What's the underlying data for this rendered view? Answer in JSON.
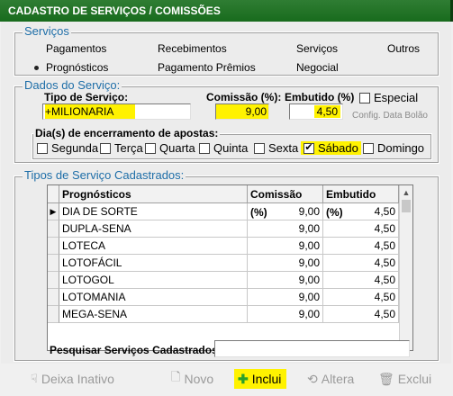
{
  "window": {
    "title": "CADASTRO DE SERVIÇOS / COMISSÕES"
  },
  "servicos": {
    "legend": "Serviços",
    "options": [
      {
        "label": "Pagamentos",
        "selected": false
      },
      {
        "label": "Recebimentos",
        "selected": false
      },
      {
        "label": "Serviços",
        "selected": false
      },
      {
        "label": "Outros",
        "selected": false
      },
      {
        "label": "Prognósticos",
        "selected": true
      },
      {
        "label": "Pagamento Prêmios",
        "selected": false
      },
      {
        "label": "Negocial",
        "selected": false
      }
    ]
  },
  "dados": {
    "legend": "Dados do Serviço:",
    "tipo_label": "Tipo de Serviço:",
    "tipo_value": "+MILIONARIA",
    "comissao_label": "Comissão (%):",
    "comissao_value": "9,00",
    "embutido_label": "Embutido (%)",
    "embutido_value": "4,50",
    "especial_label": "Especial",
    "config_label": "Config. Data Bolão",
    "dias_legend": "Dia(s) de encerramento de apostas:",
    "dias": [
      {
        "label": "Segunda",
        "checked": false
      },
      {
        "label": "Terça",
        "checked": false
      },
      {
        "label": "Quarta",
        "checked": false
      },
      {
        "label": "Quinta",
        "checked": false
      },
      {
        "label": "Sexta",
        "checked": false
      },
      {
        "label": "Sábado",
        "checked": true
      },
      {
        "label": "Domingo",
        "checked": false
      }
    ]
  },
  "tipos": {
    "legend": "Tipos de Serviço Cadastrados:",
    "columns": [
      "Prognósticos",
      "Comissão (%)",
      "Embutido (%)"
    ],
    "rows": [
      [
        "DIA DE SORTE",
        "9,00",
        "4,50"
      ],
      [
        "DUPLA-SENA",
        "9,00",
        "4,50"
      ],
      [
        "LOTECA",
        "9,00",
        "4,50"
      ],
      [
        "LOTOFÁCIL",
        "9,00",
        "4,50"
      ],
      [
        "LOTOGOL",
        "9,00",
        "4,50"
      ],
      [
        "LOTOMANIA",
        "9,00",
        "4,50"
      ],
      [
        "MEGA-SENA",
        "9,00",
        "4,50"
      ]
    ],
    "search_label": "Pesquisar Serviços Cadastrados:",
    "search_value": ""
  },
  "toolbar": {
    "deixa_inativo": "Deixa Inativo",
    "novo": "Novo",
    "inclui": "Inclui",
    "altera": "Altera",
    "exclui": "Exclui"
  },
  "colors": {
    "title_bar": "#186b1d",
    "legend": "#1e6ea8",
    "highlight": "#fff200"
  }
}
